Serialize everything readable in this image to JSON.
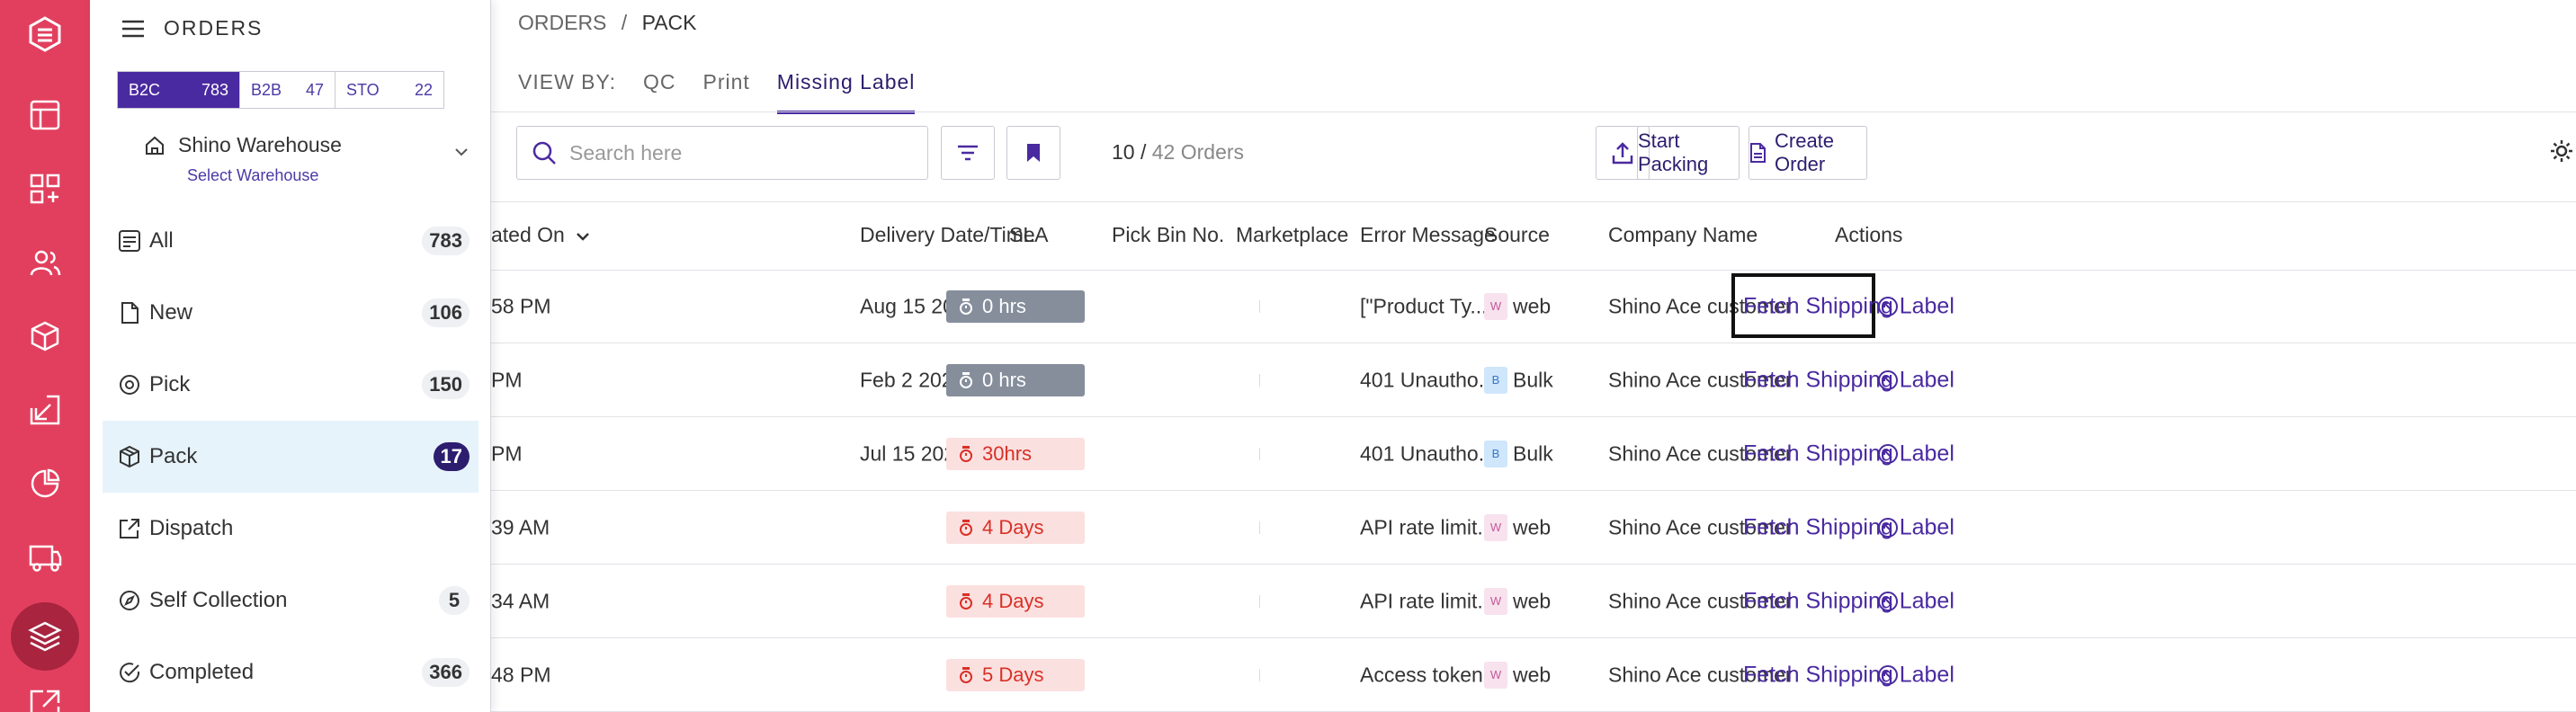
{
  "rail": {
    "icons": [
      "logo-icon",
      "layout-icon",
      "dashboard-icon",
      "users-icon",
      "cube-icon",
      "inbound-icon",
      "reports-icon",
      "truck-icon",
      "layers-icon",
      "export-icon"
    ]
  },
  "sidebar": {
    "title": "ORDERS",
    "segments": [
      {
        "label": "B2C",
        "count": "783"
      },
      {
        "label": "B2B",
        "count": "47"
      },
      {
        "label": "STO",
        "count": "22"
      }
    ],
    "warehouse": {
      "name": "Shino Warehouse",
      "sub": "Select Warehouse"
    },
    "nav": [
      {
        "label": "All",
        "count": "783",
        "icon": "list-icon"
      },
      {
        "label": "New",
        "count": "106",
        "icon": "file-icon"
      },
      {
        "label": "Pick",
        "count": "150",
        "icon": "target-icon"
      },
      {
        "label": "Pack",
        "count": "17",
        "icon": "box-icon"
      },
      {
        "label": "Dispatch",
        "count": "",
        "icon": "external-link-icon"
      },
      {
        "label": "Self Collection",
        "count": "5",
        "icon": "compass-icon"
      },
      {
        "label": "Completed",
        "count": "366",
        "icon": "check-circle-icon"
      }
    ]
  },
  "breadcrumb": {
    "root": "ORDERS",
    "sep": "/",
    "current": "PACK"
  },
  "viewby": {
    "label": "VIEW BY:",
    "tabs": [
      "QC",
      "Print",
      "Missing Label"
    ]
  },
  "toolbar": {
    "search_placeholder": "Search here",
    "count_shown": "10 /",
    "count_total": "42 Orders",
    "start_packing": "Start Packing",
    "create_order": "Create Order"
  },
  "table": {
    "headers": {
      "created": "ated On",
      "delivery": "Delivery Date/Time",
      "sla": "SLA",
      "bin": "Pick Bin No.",
      "marketplace": "Marketplace",
      "error": "Error Message",
      "source": "Source",
      "company": "Company Name",
      "actions": "Actions"
    },
    "rows": [
      {
        "created": "58 PM",
        "delivery": "Aug 15 2023, 7...",
        "sla": "0 hrs",
        "sla_tone": "grey",
        "error": "[\"Product Ty...",
        "src_letter": "W",
        "src_tone": "w",
        "source": "web",
        "company": "Shino Ace customer",
        "action": "Fetch Shipping Label"
      },
      {
        "created": " PM",
        "delivery": "Feb 2 2023, 7:...",
        "sla": "0 hrs",
        "sla_tone": "grey",
        "error": "401 Unautho...",
        "src_letter": "B",
        "src_tone": "b",
        "source": "Bulk",
        "company": "Shino Ace customer",
        "action": "Fetch Shipping Label"
      },
      {
        "created": " PM",
        "delivery": "Jul 15 2023, 7:...",
        "sla": "30hrs",
        "sla_tone": "red",
        "error": "401 Unautho...",
        "src_letter": "B",
        "src_tone": "b",
        "source": "Bulk",
        "company": "Shino Ace customer",
        "action": "Fetch Shipping Label"
      },
      {
        "created": "39 AM",
        "delivery": "",
        "sla": "4 Days",
        "sla_tone": "red",
        "error": "API rate limit...",
        "src_letter": "W",
        "src_tone": "w",
        "source": "web",
        "company": "Shino Ace customer",
        "action": "Fetch Shipping Label"
      },
      {
        "created": "34 AM",
        "delivery": "",
        "sla": "4 Days",
        "sla_tone": "red",
        "error": "API rate limit...",
        "src_letter": "W",
        "src_tone": "w",
        "source": "web",
        "company": "Shino Ace customer",
        "action": "Fetch Shipping Label"
      },
      {
        "created": "48 PM",
        "delivery": "",
        "sla": "5 Days",
        "sla_tone": "red",
        "error": "Access token...",
        "src_letter": "W",
        "src_tone": "w",
        "source": "web",
        "company": "Shino Ace customer",
        "action": "Fetch Shipping Label"
      }
    ]
  },
  "colors": {
    "rail": "#e23f5e",
    "accent": "#4a2aa0",
    "active_nav": "#e6f3fb"
  }
}
